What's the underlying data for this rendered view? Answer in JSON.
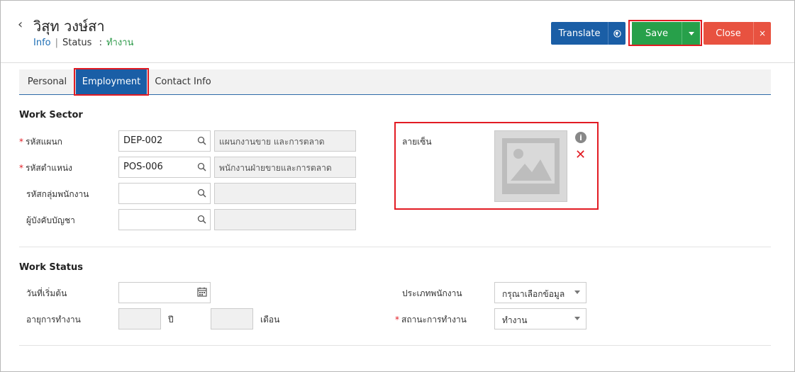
{
  "header": {
    "title": "วิสุท วงษ์สา",
    "info_link": "Info",
    "status_label": "Status",
    "status_colon": ":",
    "status_value": "ทำงาน",
    "separator": "|",
    "back_glyph": "‹",
    "translate_label": "Translate",
    "save_label": "Save",
    "close_label": "Close",
    "close_x": "×"
  },
  "tabs": [
    {
      "label": "Personal"
    },
    {
      "label": "Employment"
    },
    {
      "label": "Contact Info"
    }
  ],
  "work_sector": {
    "title": "Work Sector",
    "department": {
      "label": "รหัสแผนก",
      "code": "DEP-002",
      "name": "แผนกงานขาย และการตลาด"
    },
    "position": {
      "label": "รหัสตำแหน่ง",
      "code": "POS-006",
      "name": "พนักงานฝ่ายขายและการตลาด"
    },
    "employee_group": {
      "label": "รหัสกลุ่มพนักงาน",
      "code": "",
      "name": ""
    },
    "supervisor": {
      "label": "ผู้บังคับบัญชา",
      "code": "",
      "name": ""
    },
    "signature_label": "ลายเซ็น",
    "info_glyph": "i",
    "delete_glyph": "✕"
  },
  "work_status": {
    "title": "Work Status",
    "start_date_label": "วันที่เริ่มต้น",
    "start_date_value": "",
    "tenure_label": "อายุการทำงาน",
    "years_value": "",
    "years_unit": "ปี",
    "months_value": "",
    "months_unit": "เดือน",
    "employee_type_label": "ประเภทพนักงาน",
    "employee_type_value": "กรุณาเลือกข้อมูล",
    "work_status_label": "สถานะการทำงาน",
    "work_status_value": "ทำงาน",
    "required_mark": "*"
  },
  "colors": {
    "primary": "#1a5ea6",
    "save": "#27a04a",
    "close": "#e85240",
    "highlight": "#e21b23",
    "status_text": "#2e9a4a"
  }
}
